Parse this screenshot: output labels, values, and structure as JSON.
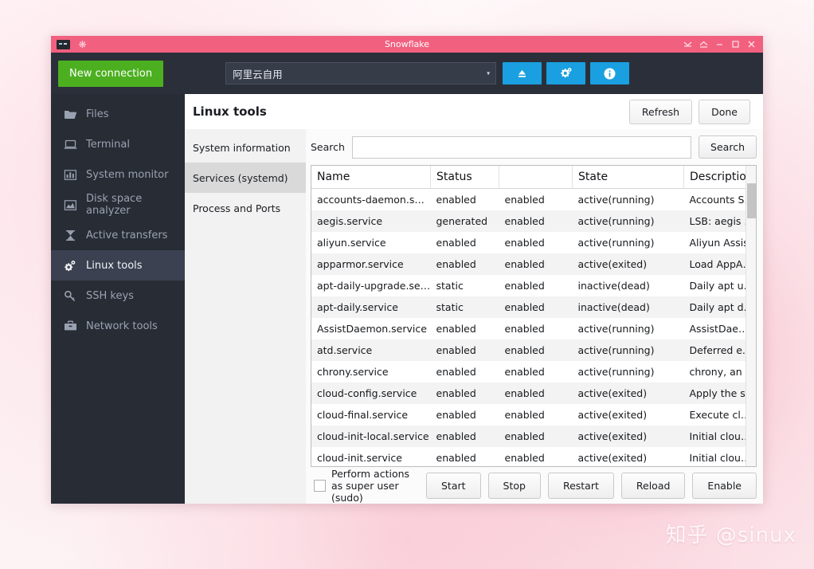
{
  "window": {
    "title": "Snowflake",
    "title_icons": [
      "terminal-icon",
      "snowflake-icon"
    ],
    "controls": [
      {
        "name": "shade-window-button",
        "glyph": "shade"
      },
      {
        "name": "rollup-window-button",
        "glyph": "chevron-up"
      },
      {
        "name": "minimize-button",
        "glyph": "minimize"
      },
      {
        "name": "maximize-button",
        "glyph": "maximize"
      },
      {
        "name": "close-button",
        "glyph": "close"
      }
    ],
    "titlebar_color": "#f2607f"
  },
  "toolbar": {
    "new_connection_label": "New connection",
    "new_connection_color": "#4caf20",
    "connection_value": "阿里云自用",
    "connection_caret": "▾",
    "actions": [
      {
        "name": "upload-button",
        "icon": "eject-icon"
      },
      {
        "name": "settings-button",
        "icon": "gears-icon"
      },
      {
        "name": "info-button",
        "icon": "info-icon"
      }
    ],
    "action_color": "#1a9fe0"
  },
  "sidebar": {
    "items": [
      {
        "label": "Files",
        "icon": "folder-icon",
        "active": false
      },
      {
        "label": "Terminal",
        "icon": "laptop-icon",
        "active": false
      },
      {
        "label": "System monitor",
        "icon": "bar-chart-icon",
        "active": false
      },
      {
        "label": "Disk space analyzer",
        "icon": "area-chart-icon",
        "active": false
      },
      {
        "label": "Active transfers",
        "icon": "hourglass-icon",
        "active": false
      },
      {
        "label": "Linux tools",
        "icon": "gears-icon",
        "active": true
      },
      {
        "label": "SSH keys",
        "icon": "key-icon",
        "active": false
      },
      {
        "label": "Network tools",
        "icon": "toolbox-icon",
        "active": false
      }
    ]
  },
  "main": {
    "title": "Linux tools",
    "refresh_label": "Refresh",
    "done_label": "Done",
    "tabs": [
      {
        "label": "System information",
        "active": false
      },
      {
        "label": "Services (systemd)",
        "active": true
      },
      {
        "label": "Process and Ports",
        "active": false
      }
    ],
    "search": {
      "label": "Search",
      "value": "",
      "placeholder": "",
      "button_label": "Search"
    },
    "table": {
      "headers": [
        "Name",
        "Status",
        "State",
        "Description"
      ],
      "rows": [
        [
          "accounts-daemon.se…",
          "enabled",
          "enabled",
          "active(running)",
          "Accounts Service"
        ],
        [
          "aegis.service",
          "generated",
          "enabled",
          "active(running)",
          "LSB: aegis update."
        ],
        [
          "aliyun.service",
          "enabled",
          "enabled",
          "active(running)",
          "Aliyun Assist"
        ],
        [
          "apparmor.service",
          "enabled",
          "enabled",
          "active(exited)",
          "Load AppArmor profil…"
        ],
        [
          "apt-daily-upgrade.se…",
          "static",
          "enabled",
          "inactive(dead)",
          "Daily apt upgrade an…"
        ],
        [
          "apt-daily.service",
          "static",
          "enabled",
          "inactive(dead)",
          "Daily apt download a…"
        ],
        [
          "AssistDaemon.service",
          "enabled",
          "enabled",
          "active(running)",
          "AssistDaemon"
        ],
        [
          "atd.service",
          "enabled",
          "enabled",
          "active(running)",
          "Deferred execution s…"
        ],
        [
          "chrony.service",
          "enabled",
          "enabled",
          "active(running)",
          "chrony, an NTP client…"
        ],
        [
          "cloud-config.service",
          "enabled",
          "enabled",
          "active(exited)",
          "Apply the settings sp…"
        ],
        [
          "cloud-final.service",
          "enabled",
          "enabled",
          "active(exited)",
          "Execute cloud user/fi…"
        ],
        [
          "cloud-init-local.service",
          "enabled",
          "enabled",
          "active(exited)",
          "Initial cloud-init job (…"
        ],
        [
          "cloud-init.service",
          "enabled",
          "enabled",
          "active(exited)",
          "Initial cloud-init job (…"
        ]
      ]
    },
    "bottom": {
      "sudo_label": "Perform actions as super user (sudo)",
      "sudo_checked": false,
      "buttons": [
        "Start",
        "Stop",
        "Restart",
        "Reload",
        "Enable"
      ]
    }
  },
  "watermark": "知乎 @sinux"
}
